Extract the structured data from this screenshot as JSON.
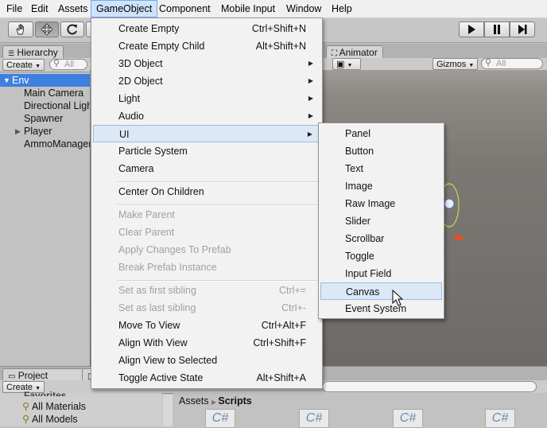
{
  "menubar": [
    "File",
    "Edit",
    "Assets",
    "GameObject",
    "Component",
    "Mobile Input",
    "Window",
    "Help"
  ],
  "hierarchy": {
    "tab": "Hierarchy",
    "create": "Create",
    "search_placeholder": "All",
    "items": [
      "Env",
      "Main Camera",
      "Directional Ligh",
      "Spawner",
      "Player",
      "AmmoManager"
    ]
  },
  "scene": {
    "animator_tab": "Animator",
    "gizmos": "Gizmos",
    "search_placeholder": "All"
  },
  "project": {
    "tab": "Project",
    "create": "Create",
    "favorites": "Favorites",
    "fav_items": [
      "All Materials",
      "All Models"
    ],
    "breadcrumb": [
      "Assets",
      "Scripts"
    ],
    "script_glyph": "C#"
  },
  "gameobject_menu": {
    "items": [
      {
        "label": "Create Empty",
        "shortcut": "Ctrl+Shift+N"
      },
      {
        "label": "Create Empty Child",
        "shortcut": "Alt+Shift+N"
      },
      {
        "label": "3D Object",
        "submenu": true
      },
      {
        "label": "2D Object",
        "submenu": true
      },
      {
        "label": "Light",
        "submenu": true
      },
      {
        "label": "Audio",
        "submenu": true
      },
      {
        "label": "UI",
        "submenu": true,
        "highlight": true
      },
      {
        "label": "Particle System"
      },
      {
        "label": "Camera"
      },
      {
        "separator": true
      },
      {
        "label": "Center On Children"
      },
      {
        "separator": true
      },
      {
        "label": "Make Parent",
        "disabled": true
      },
      {
        "label": "Clear Parent",
        "disabled": true
      },
      {
        "label": "Apply Changes To Prefab",
        "disabled": true
      },
      {
        "label": "Break Prefab Instance",
        "disabled": true
      },
      {
        "separator": true
      },
      {
        "label": "Set as first sibling",
        "shortcut": "Ctrl+=",
        "disabled": true
      },
      {
        "label": "Set as last sibling",
        "shortcut": "Ctrl+-",
        "disabled": true
      },
      {
        "label": "Move To View",
        "shortcut": "Ctrl+Alt+F"
      },
      {
        "label": "Align With View",
        "shortcut": "Ctrl+Shift+F"
      },
      {
        "label": "Align View to Selected"
      },
      {
        "label": "Toggle Active State",
        "shortcut": "Alt+Shift+A"
      }
    ]
  },
  "ui_submenu": {
    "items": [
      {
        "label": "Panel"
      },
      {
        "label": "Button"
      },
      {
        "label": "Text"
      },
      {
        "label": "Image"
      },
      {
        "label": "Raw Image"
      },
      {
        "label": "Slider"
      },
      {
        "label": "Scrollbar"
      },
      {
        "label": "Toggle"
      },
      {
        "label": "Input Field"
      },
      {
        "label": "Canvas",
        "highlight": true
      },
      {
        "label": "Event System"
      }
    ]
  },
  "icons": {
    "tools": [
      "hand-icon",
      "move-icon",
      "rotate-icon"
    ],
    "playback": [
      "play-icon",
      "pause-icon",
      "step-icon"
    ]
  }
}
